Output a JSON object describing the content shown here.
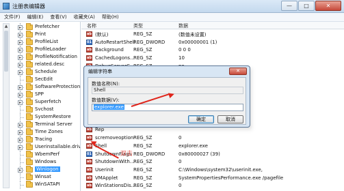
{
  "window": {
    "title": "注册表编辑器",
    "controls": [
      "—",
      "□",
      "✕"
    ]
  },
  "menu": [
    "文件(F)",
    "编辑(E)",
    "查看(V)",
    "收藏夹(A)",
    "帮助(H)"
  ],
  "tree": {
    "items": [
      {
        "label": "Prefetcher",
        "expandable": true
      },
      {
        "label": "Print",
        "expandable": true
      },
      {
        "label": "ProfileList",
        "expandable": true
      },
      {
        "label": "ProfileLoader",
        "expandable": true
      },
      {
        "label": "ProfileNotification",
        "expandable": true
      },
      {
        "label": "related.desc",
        "expandable": true
      },
      {
        "label": "Schedule",
        "expandable": true
      },
      {
        "label": "SecEdit",
        "expandable": false
      },
      {
        "label": "SoftwareProtectionP",
        "expandable": true
      },
      {
        "label": "SPP",
        "expandable": true
      },
      {
        "label": "Superfetch",
        "expandable": true
      },
      {
        "label": "Svchost",
        "expandable": false
      },
      {
        "label": "SystemRestore",
        "expandable": false
      },
      {
        "label": "Terminal Server",
        "expandable": true
      },
      {
        "label": "Time Zones",
        "expandable": true
      },
      {
        "label": "Tracing",
        "expandable": true
      },
      {
        "label": "Userinstallable.driv",
        "expandable": true
      },
      {
        "label": "WbemPerf",
        "expandable": false
      },
      {
        "label": "Windows",
        "expandable": false
      },
      {
        "label": "Winlogon",
        "expandable": true,
        "selected": true
      },
      {
        "label": "Winsat",
        "expandable": false
      },
      {
        "label": "WinSATAPI",
        "expandable": false
      }
    ]
  },
  "list": {
    "headers": {
      "name": "名称",
      "type": "类型",
      "data": "数据"
    },
    "rows": [
      {
        "name": "(默认)",
        "type": "REG_SZ",
        "data": "(数值未设置)",
        "kind": "sz"
      },
      {
        "name": "AutoRestartShell",
        "type": "REG_DWORD",
        "data": "0x00000001 (1)",
        "kind": "dw"
      },
      {
        "name": "Background",
        "type": "REG_SZ",
        "data": "0 0 0",
        "kind": "sz"
      },
      {
        "name": "CachedLogons...",
        "type": "REG_SZ",
        "data": "10",
        "kind": "sz"
      },
      {
        "name": "DebugServerC...",
        "type": "REG_SZ",
        "data": "no",
        "kind": "sz"
      },
      {
        "name": "Disa",
        "type": "",
        "data": "",
        "kind": "sz"
      },
      {
        "name": "Forc",
        "type": "",
        "data": "",
        "kind": "sz"
      },
      {
        "name": "Lega",
        "type": "",
        "data": "",
        "kind": "sz"
      },
      {
        "name": "Lega",
        "type": "",
        "data": "",
        "kind": "sz"
      },
      {
        "name": "Pass",
        "type": "",
        "data": "",
        "kind": "sz"
      },
      {
        "name": "Pow",
        "type": "",
        "data": "",
        "kind": "sz"
      },
      {
        "name": "Pre",
        "type": "",
        "data": "4C3C5AF16}",
        "kind": "sz"
      },
      {
        "name": "Rep",
        "type": "",
        "data": "",
        "kind": "sz"
      },
      {
        "name": "scremoveoption",
        "type": "REG_SZ",
        "data": "0",
        "kind": "sz"
      },
      {
        "name": "Shell",
        "type": "REG_SZ",
        "data": "explorer.exe",
        "kind": "sz"
      },
      {
        "name": "ShutdownFlags",
        "type": "REG_DWORD",
        "data": "0x80000027 (39)",
        "kind": "dw"
      },
      {
        "name": "ShutdownWith...",
        "type": "REG_SZ",
        "data": "0",
        "kind": "sz"
      },
      {
        "name": "Userinit",
        "type": "REG_SZ",
        "data": "C:\\Windows\\system32\\userinit.exe,",
        "kind": "sz"
      },
      {
        "name": "VMApplet",
        "type": "REG_SZ",
        "data": "SystemPropertiesPerformance.exe /pagefile",
        "kind": "sz"
      },
      {
        "name": "WinStationsDis...",
        "type": "REG_SZ",
        "data": "0",
        "kind": "sz"
      }
    ]
  },
  "dialog": {
    "title": "编辑字符串",
    "close": "✕",
    "name_label": "数值名称(N):",
    "name_value": "Shell",
    "data_label": "数值数据(V):",
    "data_value": "explorer.exe",
    "ok": "确定",
    "cancel": "取消"
  },
  "annotations": {
    "arrow_color": "#e0261c",
    "watermark": "双击"
  }
}
